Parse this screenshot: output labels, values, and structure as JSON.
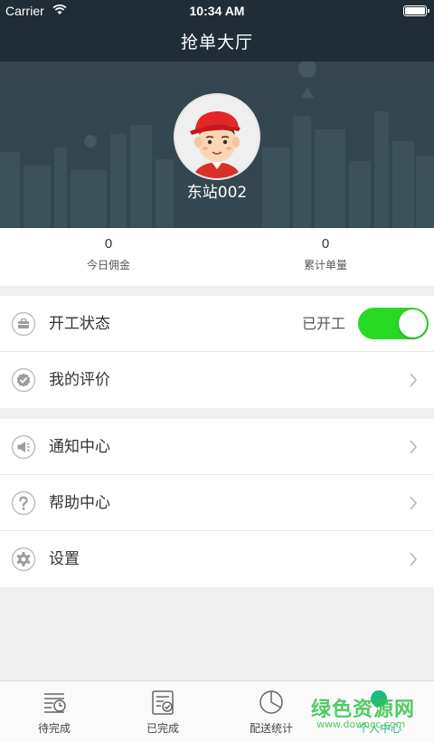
{
  "status_bar": {
    "carrier": "Carrier",
    "time": "10:34 AM"
  },
  "nav": {
    "title": "抢单大厅"
  },
  "profile": {
    "username": "东站002"
  },
  "stats": [
    {
      "value": "0",
      "label": "今日佣金"
    },
    {
      "value": "0",
      "label": "累计单量"
    }
  ],
  "menu": {
    "work_status": {
      "label": "开工状态",
      "state_text": "已开工",
      "toggle_on": true,
      "icon": "briefcase-icon"
    },
    "my_reviews": {
      "label": "我的评价",
      "icon": "check-badge-icon"
    },
    "notifications": {
      "label": "通知中心",
      "icon": "megaphone-icon"
    },
    "help": {
      "label": "帮助中心",
      "icon": "question-icon"
    },
    "settings": {
      "label": "设置",
      "icon": "gear-icon"
    }
  },
  "tabs": [
    {
      "label": "待完成",
      "icon": "pending-list-icon"
    },
    {
      "label": "已完成",
      "icon": "completed-list-icon"
    },
    {
      "label": "配送统计",
      "icon": "pie-chart-icon"
    },
    {
      "label": "个人中心",
      "icon": "person-icon",
      "active": true
    }
  ],
  "watermark": {
    "text": "绿色资源网",
    "url": "www.downcc.com"
  },
  "colors": {
    "header": "#1f2d36",
    "banner": "#34464f",
    "toggle_on": "#28d924",
    "active_tab": "#1eb980"
  }
}
